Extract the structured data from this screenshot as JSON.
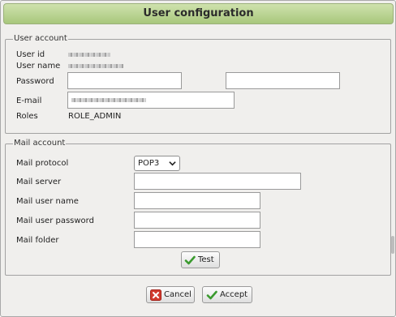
{
  "dialog": {
    "title": "User configuration"
  },
  "user_account": {
    "legend": "User account",
    "user_id_label": "User id",
    "user_name_label": "User name",
    "password_label": "Password",
    "password_value": "",
    "password_confirm_value": "",
    "email_label": "E-mail",
    "roles_label": "Roles",
    "roles_value": "ROLE_ADMIN"
  },
  "mail_account": {
    "legend": "Mail account",
    "protocol_label": "Mail protocol",
    "protocol_value": "POP3",
    "server_label": "Mail server",
    "server_value": "",
    "user_name_label": "Mail user name",
    "user_name_value": "",
    "user_password_label": "Mail user password",
    "user_password_value": "",
    "folder_label": "Mail folder",
    "folder_value": "",
    "test_button": "Test"
  },
  "footer": {
    "cancel_button": "Cancel",
    "accept_button": "Accept"
  },
  "icons": {
    "chevron": "chevron-down-icon",
    "check": "check-icon",
    "cancel": "cancel-icon"
  },
  "colors": {
    "titlebar": "#b7d18d",
    "accept_check": "#3a9a2e",
    "cancel_icon": "#d23b2f"
  }
}
